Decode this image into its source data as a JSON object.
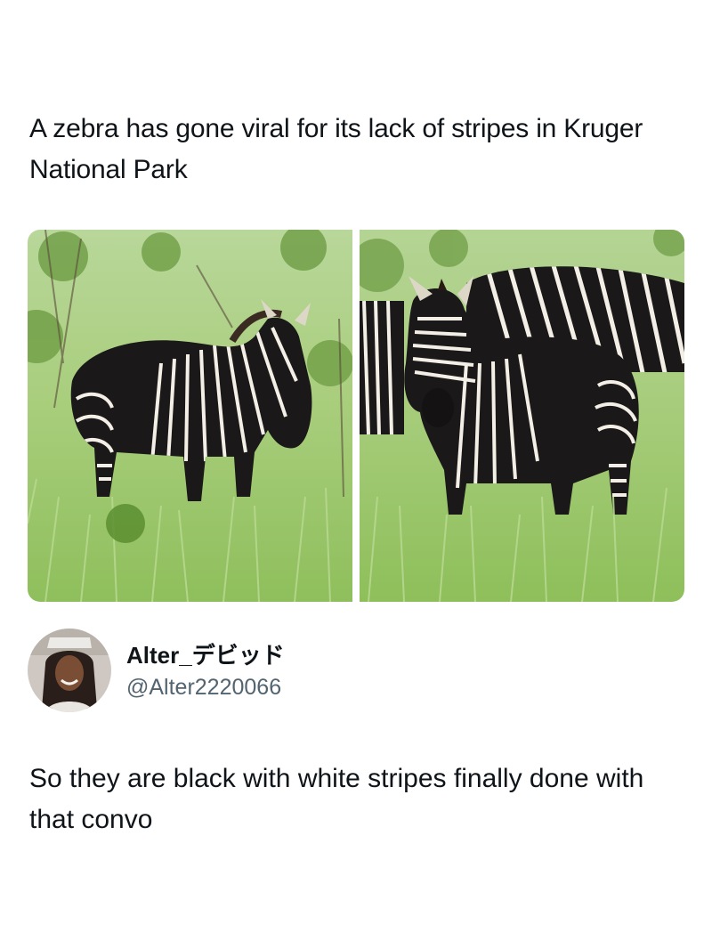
{
  "post": {
    "headline": "A zebra has gone viral for its lack of stripes in Kruger National Park",
    "images": [
      {
        "subject": "black zebra with white stripes standing in tall grass, facing right"
      },
      {
        "subject": "black zebra with white stripes facing camera, second zebra behind"
      }
    ]
  },
  "reply": {
    "display_name": "Alter_デビッド",
    "handle": "@Alter2220066",
    "text": "So they are black with white stripes finally done with that convo"
  },
  "colors": {
    "text_primary": "#0f1419",
    "text_secondary": "#536471",
    "grass": "#9cc46a",
    "zebra_dark": "#1a1818"
  }
}
